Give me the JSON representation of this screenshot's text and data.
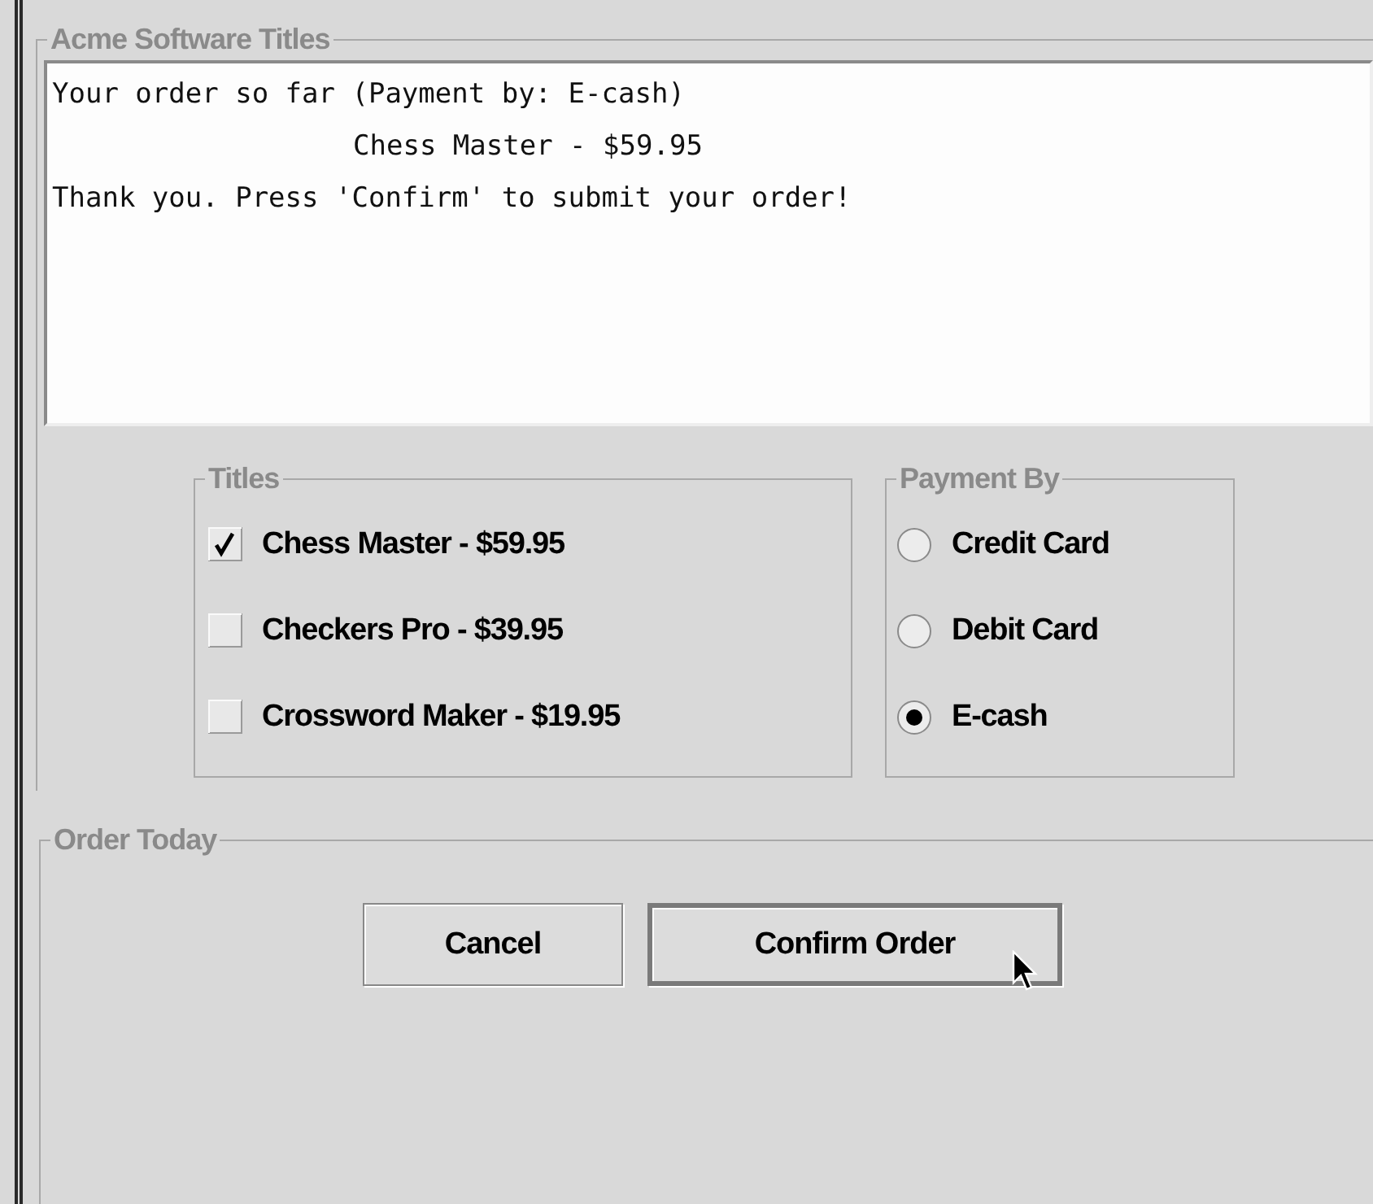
{
  "panel": {
    "title": "Acme Software Titles"
  },
  "order_summary": {
    "header": "Your order so far (Payment by: E-cash)",
    "items": [
      {
        "text": "Chess Master - $59.95"
      }
    ],
    "message": "Thank you. Press 'Confirm' to submit your order!"
  },
  "titles": {
    "title": "Titles",
    "items": [
      {
        "label": "Chess Master - $59.95",
        "checked": true
      },
      {
        "label": "Checkers Pro - $39.95",
        "checked": false
      },
      {
        "label": "Crossword Maker - $19.95",
        "checked": false
      }
    ]
  },
  "payment": {
    "title": "Payment By",
    "options": [
      {
        "label": "Credit Card",
        "selected": false
      },
      {
        "label": "Debit Card",
        "selected": false
      },
      {
        "label": "E-cash",
        "selected": true
      }
    ]
  },
  "order": {
    "title": "Order Today",
    "buttons": [
      {
        "label": "Cancel",
        "default": false
      },
      {
        "label": "Confirm Order",
        "default": true
      }
    ]
  }
}
